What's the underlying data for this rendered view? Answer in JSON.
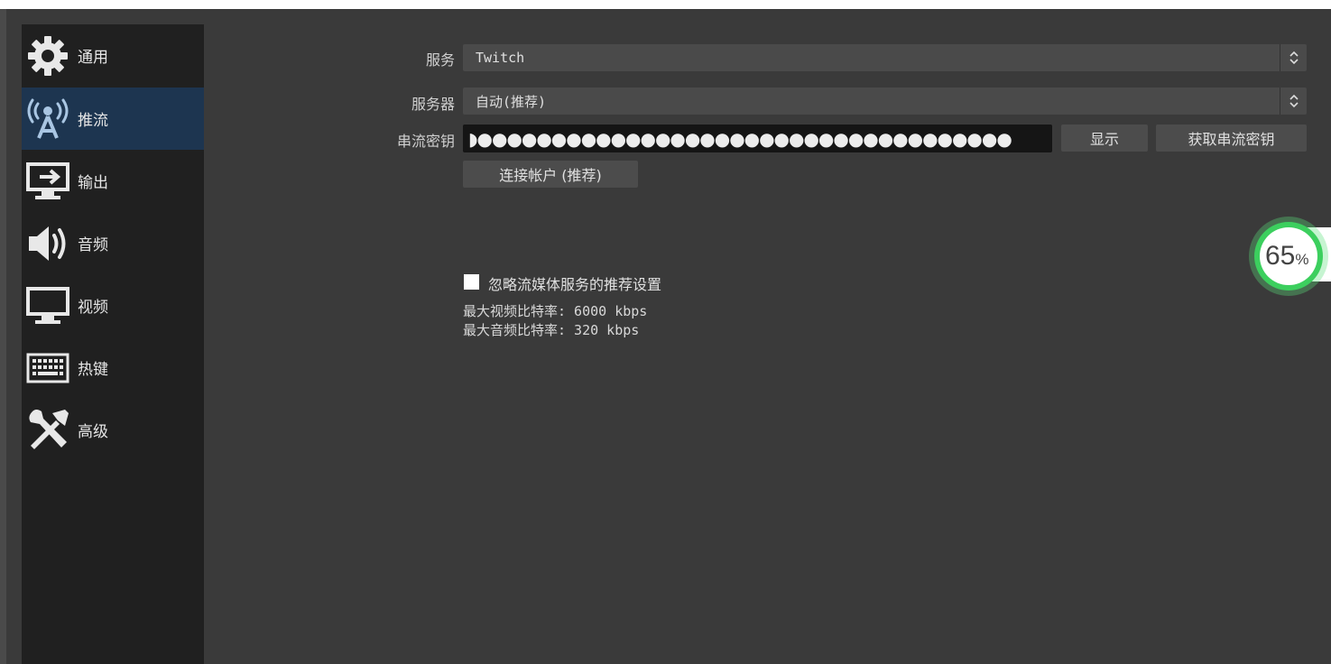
{
  "sidebar": {
    "items": [
      {
        "label": "通用",
        "icon": "gear-icon"
      },
      {
        "label": "推流",
        "icon": "antenna-icon"
      },
      {
        "label": "输出",
        "icon": "output-icon"
      },
      {
        "label": "音频",
        "icon": "speaker-icon"
      },
      {
        "label": "视频",
        "icon": "monitor-icon"
      },
      {
        "label": "热键",
        "icon": "keyboard-icon"
      },
      {
        "label": "高级",
        "icon": "tools-icon"
      }
    ],
    "active_index": 1
  },
  "stream": {
    "service_label": "服务",
    "service_value": "Twitch",
    "server_label": "服务器",
    "server_value": "自动(推荐)",
    "key_label": "串流密钥",
    "key_masked": "◗●●●●●●●●●●●●●●●●●●●●●●●●●●●●●●●●●●●●",
    "show_button": "显示",
    "get_key_button": "获取串流密钥",
    "connect_button": "连接帐户 (推荐)",
    "ignore_checkbox_label": "忽略流媒体服务的推荐设置",
    "max_video_bitrate": "最大视频比特率: 6000 kbps",
    "max_audio_bitrate": "最大音频比特率: 320 kbps"
  },
  "overlay": {
    "percent_value": "65",
    "percent_sign": "%",
    "accent_color": "#3ccf5e"
  }
}
